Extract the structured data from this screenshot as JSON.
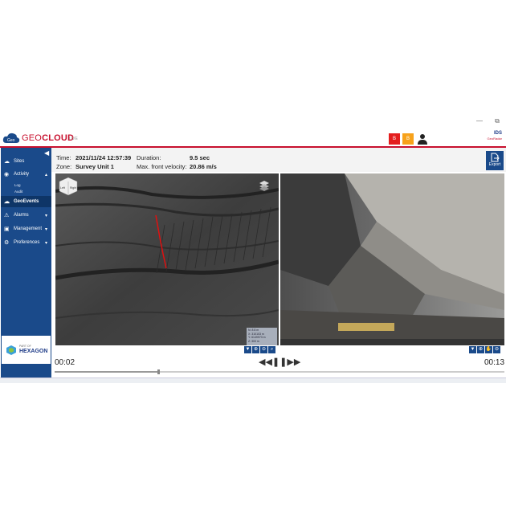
{
  "window": {
    "controls": [
      "—",
      "⧉"
    ]
  },
  "header": {
    "brand_geo": "GEO",
    "brand_cloud": "CLOUD",
    "brand_sub": "LIVE",
    "logo_text": "Geo",
    "alert_red_label": "B",
    "alert_orange_label": "B",
    "ids_title": "IDS",
    "ids_sub": "GeoRadar",
    "colors": {
      "accent": "#c8102e",
      "sidebar": "#1a4a8a",
      "alert_red": "#e41e1e",
      "alert_orange": "#f7a21b"
    }
  },
  "sidebar": {
    "items": [
      {
        "label": "Sites",
        "icon": "cloud-icon"
      },
      {
        "label": "Activity",
        "icon": "gauge-icon",
        "expanded": true
      },
      {
        "label": "GeoEvents",
        "icon": "event-icon",
        "active": true
      },
      {
        "label": "Alarms",
        "icon": "warning-icon"
      },
      {
        "label": "Management",
        "icon": "car-icon"
      },
      {
        "label": "Preferences",
        "icon": "gear-icon"
      }
    ],
    "subitems": [
      "Log",
      "Audit"
    ],
    "partner_part_of": "PART OF",
    "partner_name": "HEXAGON"
  },
  "info": {
    "time_label": "Time:",
    "time_value": "2021/11/24 12:57:39",
    "duration_label": "Duration:",
    "duration_value": "9.5 sec",
    "zone_label": "Zone:",
    "zone_value": "Survey Unit 1",
    "velocity_label": "Max. front velocity:",
    "velocity_value": "20.86 m/s",
    "export_label": "Export"
  },
  "views": {
    "cube_faces": [
      "Left",
      "Right"
    ],
    "coords": [
      "N: 8 8 m",
      "X: 310103 m",
      "Y: 6149973 m",
      "Z: 300 m"
    ]
  },
  "playback": {
    "start": "00:02",
    "end": "00:13",
    "progress": 0.23
  }
}
